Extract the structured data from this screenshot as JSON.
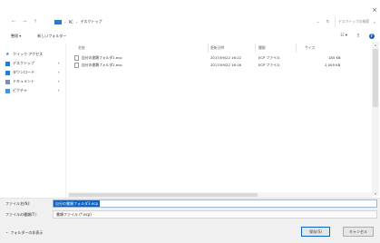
{
  "dialog": {
    "close_glyph": "×"
  },
  "nav": {
    "back_glyph": "←",
    "forward_glyph": "→",
    "up_glyph": "↑",
    "path": [
      "PC",
      "デスクトップ"
    ],
    "path_separator": "›",
    "dropdown_glyph": "⌄",
    "refresh_glyph": "↻",
    "search_placeholder": "デスクトップの検索",
    "search_glyph": "⌕"
  },
  "toolbar": {
    "organize_label": "整理 ▾",
    "new_folder_label": "新しいフォルダー",
    "view_glyph": "☷ ▾",
    "pane_glyph": "▯",
    "help_glyph": "?"
  },
  "sidebar": {
    "items": [
      {
        "label": "クイック アクセス",
        "icon": "star-icon",
        "color": "#2f78c4",
        "pinned": false
      },
      {
        "label": "デスクトップ",
        "icon": "desktop-icon",
        "color": "#2f78c4",
        "pinned": true
      },
      {
        "label": "ダウンロード",
        "icon": "download-icon",
        "color": "#2f78c4",
        "pinned": true
      },
      {
        "label": "ドキュメント",
        "icon": "document-icon",
        "color": "#7d8ea8",
        "pinned": true
      },
      {
        "label": "ピクチャ",
        "icon": "picture-icon",
        "color": "#4a8fd8",
        "pinned": true
      }
    ],
    "pin_glyph": "✦"
  },
  "filelist": {
    "columns": [
      "名前",
      "更新日時",
      "種類",
      "サイズ"
    ],
    "rows": [
      {
        "name": "自分の書類フォルダ1.ecp",
        "date": "2017/09/22 16:22",
        "type": "ECP ファイル",
        "size": "185 KB"
      },
      {
        "name": "自分の書類フォルダ2.ecp",
        "date": "2017/09/22 16:16",
        "type": "ECP ファイル",
        "size": "2,009 KB"
      }
    ]
  },
  "scroll": {
    "up_glyph": "▴",
    "down_glyph": "▾"
  },
  "save": {
    "filename_label": "ファイル名(N):",
    "filename_value": "自分の書類フォルダ3.ecp",
    "type_label": "ファイルの種類(T):",
    "type_value": "書類ファイル (*.ecp)",
    "hide_folders_label": "フォルダーの非表示",
    "hide_folders_glyph": "⌃",
    "save_button": "保存(S)",
    "cancel_button": "キャンセル"
  }
}
